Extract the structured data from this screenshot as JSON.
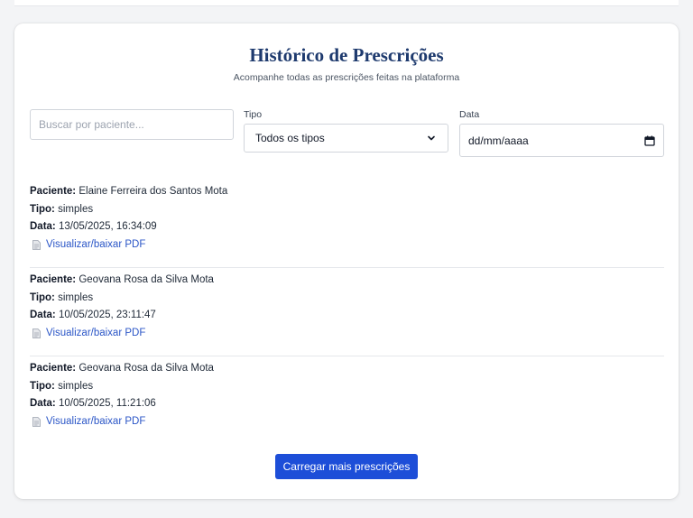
{
  "header": {
    "title": "Histórico de Prescrições",
    "subtitle": "Acompanhe todas as prescrições feitas na plataforma"
  },
  "filters": {
    "search_placeholder": "Buscar por paciente...",
    "search_value": "",
    "type_label": "Tipo",
    "type_selected": "Todos os tipos",
    "date_label": "Data",
    "date_placeholder": "dd/mm/aaaa"
  },
  "labels": {
    "patient": "Paciente:",
    "type": "Tipo:",
    "date": "Data:",
    "pdf_link": "Visualizar/baixar PDF"
  },
  "prescriptions": [
    {
      "patient": "Elaine Ferreira dos Santos Mota",
      "type": "simples",
      "date": "13/05/2025, 16:34:09"
    },
    {
      "patient": "Geovana Rosa da Silva Mota",
      "type": "simples",
      "date": "10/05/2025, 23:11:47"
    },
    {
      "patient": "Geovana Rosa da Silva Mota",
      "type": "simples",
      "date": "10/05/2025, 11:21:06"
    }
  ],
  "load_more_label": "Carregar mais prescrições",
  "colors": {
    "accent": "#1d4ed8",
    "title": "#1e3a6e",
    "link": "#2b56c7"
  },
  "icons": {
    "select": "chevron-down-icon",
    "date": "calendar-icon",
    "pdf": "document-icon"
  }
}
